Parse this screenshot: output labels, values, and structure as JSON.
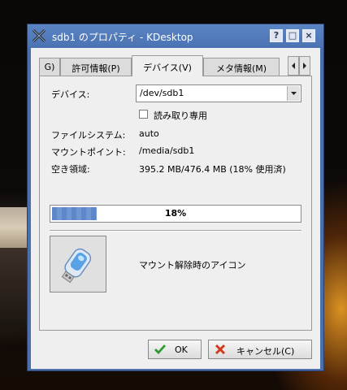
{
  "window": {
    "title": "sdb1 のプロパティ - KDesktop",
    "buttons": {
      "help": "?",
      "maximize": "□",
      "close": "×"
    }
  },
  "tabs": [
    {
      "label": "G)"
    },
    {
      "label": "許可情報(P)"
    },
    {
      "label": "デバイス(V)",
      "active": true
    },
    {
      "label": "メタ情報(M)"
    }
  ],
  "device": {
    "label": "デバイス:",
    "value": "/dev/sdb1"
  },
  "readonly": {
    "label": "読み取り専用",
    "checked": false
  },
  "info": {
    "filesystem_label": "ファイルシステム:",
    "filesystem_value": "auto",
    "mountpoint_label": "マウントポイント:",
    "mountpoint_value": "/media/sdb1",
    "free_label": "空き領域:",
    "free_value": "395.2 MB/476.4 MB (18% 使用済)"
  },
  "usage": {
    "percent": 18,
    "text": "18%"
  },
  "unmount_icon": {
    "label": "マウント解除時のアイコン",
    "icon": "usb-drive-icon"
  },
  "footer": {
    "ok_label": "OK",
    "cancel_label": "キャンセル(C)"
  },
  "colors": {
    "titlebar": "#4b73b4",
    "progress": "#5d87c8",
    "accent_ok": "#2e9a2e",
    "accent_cancel": "#d23a20"
  }
}
